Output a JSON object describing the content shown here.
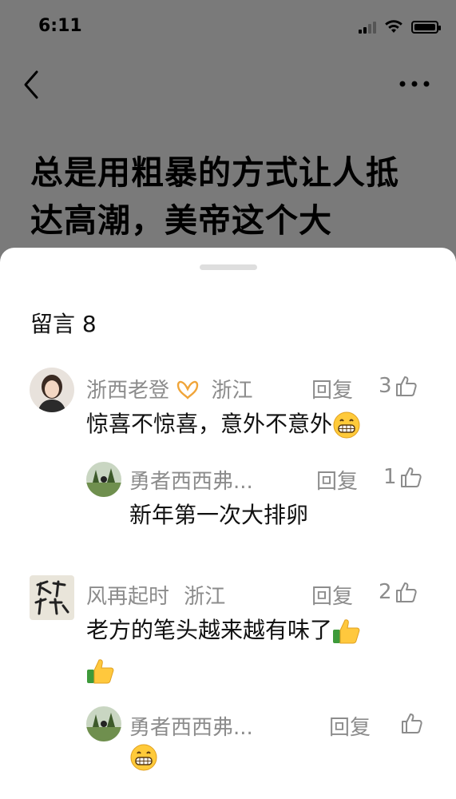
{
  "status_bar": {
    "time": "6:11"
  },
  "article": {
    "title": "总是用粗暴的方式让人抵达高潮，美帝这个大"
  },
  "comments": {
    "heading": "留言 8",
    "reply_label": "回复",
    "items": [
      {
        "author": "浙西老登",
        "location": "浙江",
        "likes": "3",
        "text": "惊喜不惊喜，意外不意外",
        "emoji": "grin-emoji",
        "reply": {
          "author": "勇者西西弗...",
          "likes": "1",
          "text": "新年第一次大排卵"
        }
      },
      {
        "author": "风再起时",
        "location": "浙江",
        "likes": "2",
        "text": "老方的笔头越来越有味了",
        "emoji": "thumbs-up-emoji",
        "reply": {
          "author": "勇者西西弗...",
          "likes": "",
          "emoji": "grin-emoji"
        }
      }
    ]
  }
}
